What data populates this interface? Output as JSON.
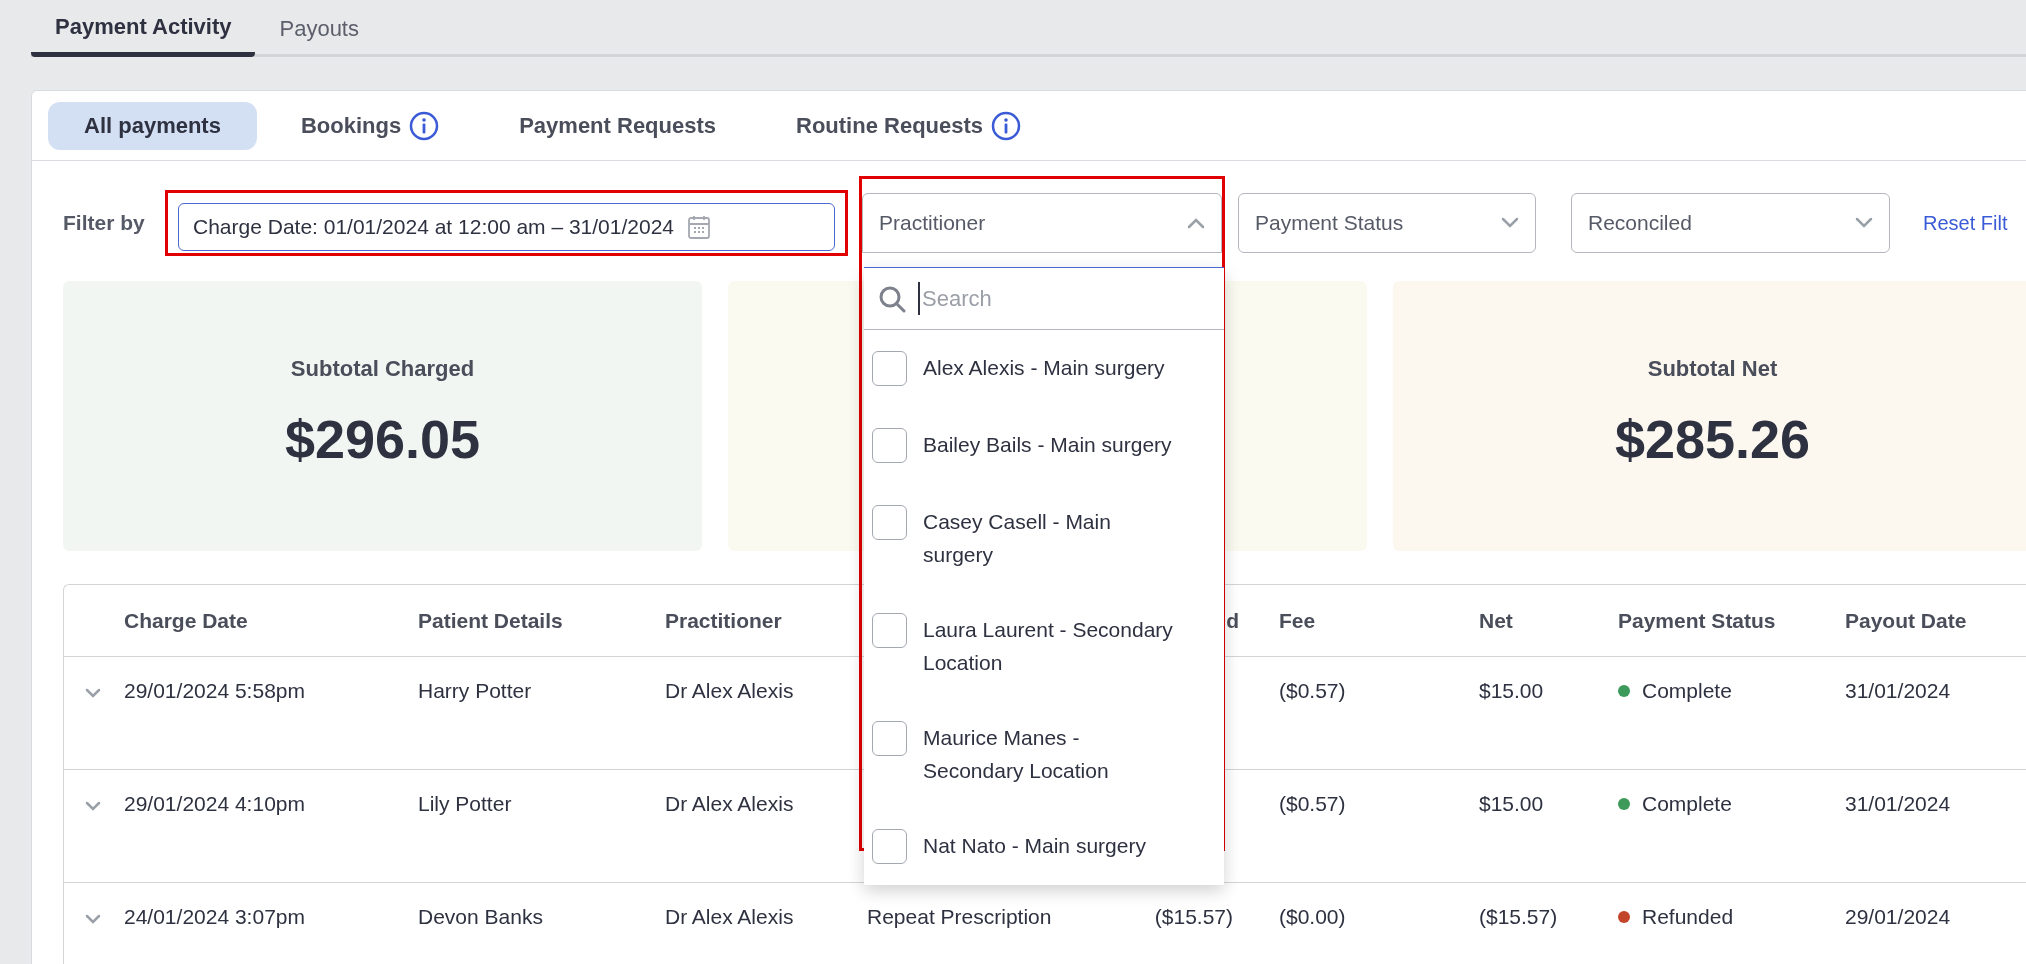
{
  "top_tabs": [
    {
      "label": "Payment Activity",
      "selected": true
    },
    {
      "label": "Payouts",
      "selected": false
    }
  ],
  "sub_tabs": [
    {
      "label": "All payments",
      "selected": true,
      "info": false
    },
    {
      "label": "Bookings",
      "selected": false,
      "info": true
    },
    {
      "label": "Payment Requests",
      "selected": false,
      "info": false
    },
    {
      "label": "Routine Requests",
      "selected": false,
      "info": true
    }
  ],
  "filters": {
    "label": "Filter by",
    "date": {
      "value": "Charge Date: 01/01/2024 at 12:00 am – 31/01/2024",
      "highlighted": true
    },
    "selects": [
      {
        "placeholder": "Practitioner",
        "expanded": true,
        "highlighted": true
      },
      {
        "placeholder": "Payment Status",
        "expanded": false,
        "highlighted": false
      },
      {
        "placeholder": "Reconciled",
        "expanded": false,
        "highlighted": false
      }
    ],
    "reset": "Reset Filt"
  },
  "practitioner_menu": {
    "search_placeholder": "Search",
    "options": [
      {
        "label": "Alex Alexis - Main surgery",
        "checked": false
      },
      {
        "label": "Bailey Bails - Main surgery",
        "checked": false
      },
      {
        "label": "Casey Casell - Main surgery",
        "checked": false
      },
      {
        "label": "Laura Laurent - Secondary Location",
        "checked": false
      },
      {
        "label": "Maurice Manes - Secondary Location",
        "checked": false
      },
      {
        "label": "Nat Nato - Main surgery",
        "checked": false
      }
    ]
  },
  "cards": [
    {
      "color": "#f1f6f3",
      "label": "Subtotal Charged",
      "value": "$296.05"
    },
    {
      "color": "#fbfaf1"
    },
    {
      "color": "#fcf8f0",
      "label": "Subtotal Net",
      "value": "$285.26"
    }
  ],
  "table": {
    "columns": [
      {
        "label": "Charge Date"
      },
      {
        "label": "Patient Details"
      },
      {
        "label": "Practitioner"
      },
      {},
      {
        "label": "d"
      },
      {
        "label": "Fee"
      },
      {
        "label": "Net"
      },
      {
        "label": "Payment Status"
      },
      {
        "label": "Payout Date"
      }
    ],
    "rows": [
      {
        "cells": [
          "29/01/2024 5:58pm",
          "Harry Potter",
          "Dr Alex Alexis",
          null,
          null,
          "($0.57)",
          "$15.00"
        ],
        "status": {
          "label": "Complete",
          "color": "#3d9a5a"
        },
        "payout": "31/01/2024"
      },
      {
        "cells": [
          "29/01/2024 4:10pm",
          "Lily Potter",
          "Dr Alex Alexis",
          null,
          null,
          "($0.57)",
          "$15.00"
        ],
        "status": {
          "label": "Complete",
          "color": "#3d9a5a"
        },
        "payout": "31/01/2024"
      },
      {
        "cells": [
          "24/01/2024 3:07pm",
          "Devon Banks",
          "Dr Alex Alexis",
          "Repeat Prescription",
          "($15.57)",
          "($0.00)",
          "($15.57)"
        ],
        "status": {
          "label": "Refunded",
          "color": "#c4462a"
        },
        "payout": "29/01/2024"
      }
    ]
  }
}
